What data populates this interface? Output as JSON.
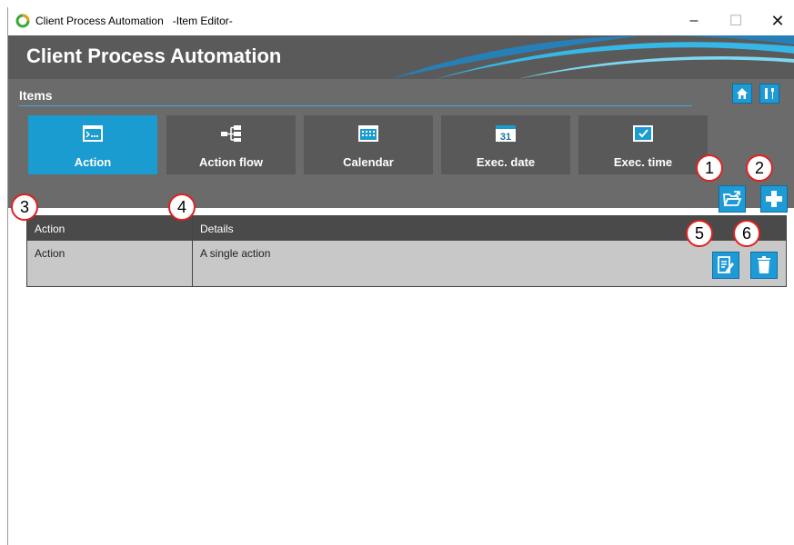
{
  "window": {
    "title": "Client Process Automation   -Item Editor-",
    "controls": {
      "minimize": "–",
      "maximize": "☐",
      "close": "✕"
    }
  },
  "banner": {
    "title": "Client Process Automation"
  },
  "items": {
    "label": "Items",
    "tiles": [
      {
        "label": "Action",
        "icon": "action-icon",
        "active": true
      },
      {
        "label": "Action flow",
        "icon": "action-flow-icon",
        "active": false
      },
      {
        "label": "Calendar",
        "icon": "calendar-icon",
        "active": false
      },
      {
        "label": "Exec. date",
        "icon": "exec-date-icon",
        "active": false,
        "icon_day": "31"
      },
      {
        "label": "Exec. time",
        "icon": "exec-time-icon",
        "active": false
      }
    ]
  },
  "grid": {
    "columns": [
      "Action",
      "Details"
    ],
    "rows": [
      {
        "action": "Action",
        "details": "A single action"
      }
    ]
  },
  "callouts": [
    "1",
    "2",
    "3",
    "4",
    "5",
    "6"
  ],
  "colors": {
    "accent": "#1a9cd0",
    "panel": "#6b6b6b",
    "banner": "#5a5a5a",
    "callout": "#e02020"
  }
}
